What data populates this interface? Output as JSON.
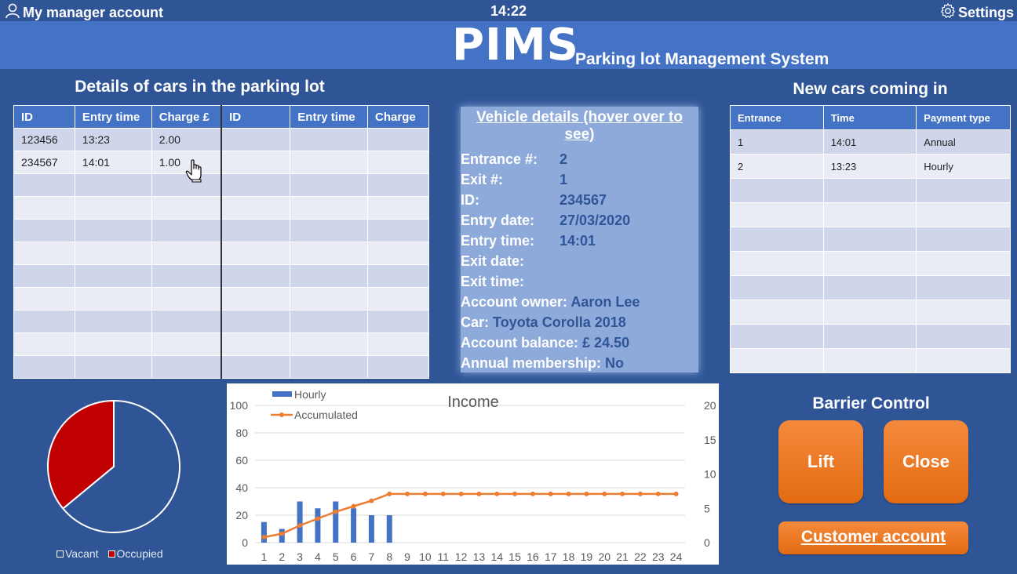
{
  "header": {
    "account_label": "My manager account",
    "time": "14:22",
    "settings_label": "Settings"
  },
  "banner": {
    "logo": "PIMS",
    "subtitle": "Parking lot Management System"
  },
  "cars": {
    "title": "Details of cars in the parking lot",
    "columns": [
      "ID",
      "Entry time",
      "Charge £",
      "ID",
      "Entry time",
      "Charge"
    ],
    "rows": [
      [
        "123456",
        "13:23",
        "2.00",
        "",
        "",
        ""
      ],
      [
        "234567",
        "14:01",
        "1.00",
        "",
        "",
        ""
      ],
      [
        "",
        "",
        "",
        "",
        "",
        ""
      ],
      [
        "",
        "",
        "",
        "",
        "",
        ""
      ],
      [
        "",
        "",
        "",
        "",
        "",
        ""
      ],
      [
        "",
        "",
        "",
        "",
        "",
        ""
      ],
      [
        "",
        "",
        "",
        "",
        "",
        ""
      ],
      [
        "",
        "",
        "",
        "",
        "",
        ""
      ],
      [
        "",
        "",
        "",
        "",
        "",
        ""
      ],
      [
        "",
        "",
        "",
        "",
        "",
        ""
      ],
      [
        "",
        "",
        "",
        "",
        "",
        ""
      ]
    ]
  },
  "vehicle": {
    "title": "Vehicle details (hover over to see)",
    "entrance_label": "Entrance #:",
    "entrance": "2",
    "exit_label": "Exit #:",
    "exit": "1",
    "id_label": "ID:",
    "id": "234567",
    "entry_date_label": "Entry date:",
    "entry_date": "27/03/2020",
    "entry_time_label": "Entry time:",
    "entry_time": "14:01",
    "exit_date_label": "Exit date:",
    "exit_date": "",
    "exit_time_label": "Exit time:",
    "exit_time": "",
    "owner_label": "Account owner:",
    "owner": "Aaron Lee",
    "car_label": "Car:",
    "car": "Toyota Corolla 2018",
    "balance_label": "Account balance:",
    "balance": "£ 24.50",
    "membership_label": "Annual membership:",
    "membership": "No"
  },
  "new_cars": {
    "title": "New cars coming in",
    "columns": [
      "Entrance",
      "Time",
      "Payment type"
    ],
    "rows": [
      [
        "1",
        "14:01",
        "Annual"
      ],
      [
        "2",
        "13:23",
        "Hourly"
      ],
      [
        "",
        "",
        ""
      ],
      [
        "",
        "",
        ""
      ],
      [
        "",
        "",
        ""
      ],
      [
        "",
        "",
        ""
      ],
      [
        "",
        "",
        ""
      ],
      [
        "",
        "",
        ""
      ],
      [
        "",
        "",
        ""
      ],
      [
        "",
        "",
        ""
      ]
    ]
  },
  "occupancy": {
    "legend_vacant": "Vacant",
    "legend_occupied": "Occupied",
    "colors": {
      "vacant": "#2f5597",
      "occupied": "#c00000"
    }
  },
  "barrier": {
    "title": "Barrier Control",
    "lift_label": "Lift",
    "close_label": "Close",
    "customer_label": "Customer account"
  },
  "chart_data": [
    {
      "type": "pie",
      "labels": [
        "Vacant",
        "Occupied"
      ],
      "values": [
        64,
        36
      ],
      "colors": [
        "#2f5597",
        "#c00000"
      ],
      "legend": "bottom"
    },
    {
      "type": "bar",
      "title": "Income",
      "categories": [
        1,
        2,
        3,
        4,
        5,
        6,
        7,
        8,
        9,
        10,
        11,
        12,
        13,
        14,
        15,
        16,
        17,
        18,
        19,
        20,
        21,
        22,
        23,
        24
      ],
      "series": [
        {
          "name": "Hourly",
          "type": "bar",
          "axis": "left",
          "color": "#4472c4",
          "values": [
            15,
            10,
            30,
            25,
            30,
            25,
            20,
            20,
            null,
            null,
            null,
            null,
            null,
            null,
            null,
            null,
            null,
            null,
            null,
            null,
            null,
            null,
            null,
            null
          ]
        },
        {
          "name": "Accumulated",
          "type": "line",
          "axis": "right",
          "color": "#ed7d31",
          "values": [
            0.8,
            1.3,
            2.5,
            3.5,
            4.5,
            5.3,
            6.1,
            7.1,
            7.1,
            7.1,
            7.1,
            7.1,
            7.1,
            7.1,
            7.1,
            7.1,
            7.1,
            7.1,
            7.1,
            7.1,
            7.1,
            7.1,
            7.1,
            7.1
          ]
        }
      ],
      "ylim_left": [
        0,
        100
      ],
      "yticks_left": [
        0,
        20,
        40,
        60,
        80,
        100
      ],
      "ylim_right": [
        0,
        20
      ],
      "yticks_right": [
        0,
        5,
        10,
        15,
        20
      ],
      "legend": "top-left",
      "grid": true
    }
  ]
}
